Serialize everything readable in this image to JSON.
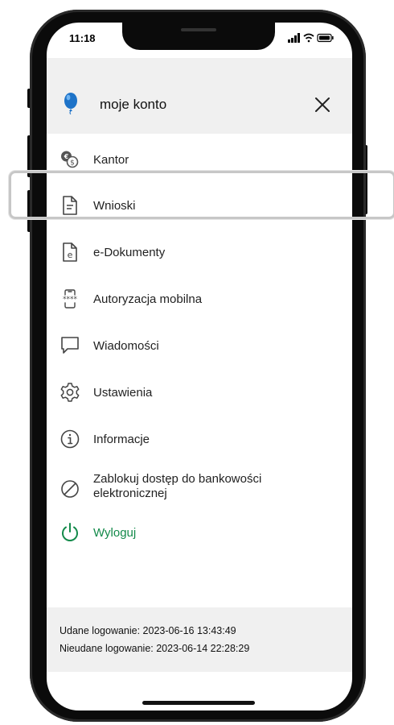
{
  "status_bar": {
    "time": "11:18"
  },
  "header": {
    "title": "moje konto",
    "close_icon": "close-icon"
  },
  "menu": {
    "items": [
      {
        "label": "Kantor",
        "icon": "currency-exchange-icon"
      },
      {
        "label": "Wnioski",
        "icon": "document-icon"
      },
      {
        "label": "e-Dokumenty",
        "icon": "e-document-icon"
      },
      {
        "label": "Autoryzacja mobilna",
        "icon": "mobile-authorization-icon"
      },
      {
        "label": "Wiadomości",
        "icon": "message-icon"
      },
      {
        "label": "Ustawienia",
        "icon": "gear-icon"
      },
      {
        "label": "Informacje",
        "icon": "info-icon"
      },
      {
        "label": "Zablokuj dostęp do bankowości elektronicznej",
        "icon": "block-icon"
      },
      {
        "label": "Wyloguj",
        "icon": "power-icon"
      }
    ]
  },
  "footer": {
    "last_login": "Udane logowanie: 2023-06-16 13:43:49",
    "failed_login": "Nieudane logowanie: 2023-06-14 22:28:29"
  },
  "colors": {
    "accent_green": "#138a4a",
    "header_bg": "#f0f0f0",
    "logo_blue": "#1e73c8"
  }
}
